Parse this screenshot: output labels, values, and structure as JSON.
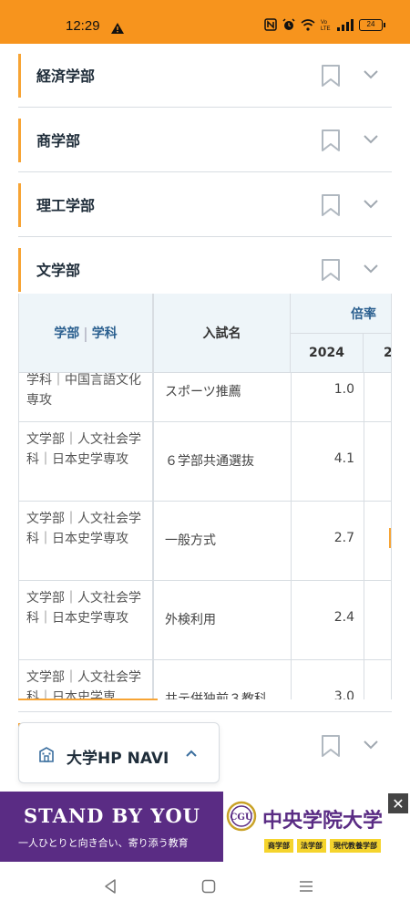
{
  "status_bar": {
    "time": "12:29",
    "battery": "24",
    "icons": [
      "warning-icon",
      "nfc-icon",
      "alarm-icon",
      "wifi-icon",
      "volte-icon",
      "signal-icon",
      "battery-icon"
    ],
    "background": "#f7941d"
  },
  "sections": [
    {
      "label": "経済学部"
    },
    {
      "label": "商学部"
    },
    {
      "label": "理工学部"
    },
    {
      "label": "文学部"
    }
  ],
  "table": {
    "headers": {
      "faculty": "学部",
      "department": "学科",
      "exam": "入試名",
      "ratio": "倍率",
      "year1": "2024",
      "year2": "2"
    },
    "rows": [
      {
        "dept": "学科｜中国言語文化専攻",
        "exam": "スポーツ推薦",
        "rate": "1.0"
      },
      {
        "dept": "文学部｜人文社会学科｜日本史学専攻",
        "exam": "６学部共通選抜",
        "rate": "4.1"
      },
      {
        "dept": "文学部｜人文社会学科｜日本史学専攻",
        "exam": "一般方式",
        "rate": "2.7"
      },
      {
        "dept": "文学部｜人文社会学科｜日本史学専攻",
        "exam": "外検利用",
        "rate": "2.4"
      },
      {
        "dept": "文学部｜人文社会学科｜日本史学専",
        "exam": "共テ併独前３教科",
        "rate": "3.0"
      }
    ]
  },
  "navi_button": {
    "label": "大学HP NAVI",
    "icon": "building-icon"
  },
  "ad": {
    "title": "STAND BY YOU",
    "subtitle": "一人ひとりと向き合い、寄り添う教育",
    "university": "中央学院大学",
    "logo_text": "CGU",
    "tags": [
      "商学部",
      "法学部",
      "現代教養学部"
    ],
    "accent": "#5a2c84"
  },
  "colors": {
    "accent_orange": "#f7a435",
    "header_bg": "#eef5f9",
    "header_text_blue": "#2a5f8f"
  }
}
